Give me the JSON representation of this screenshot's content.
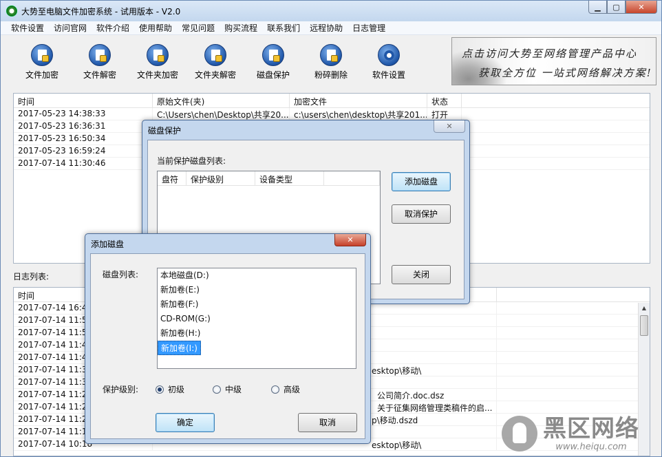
{
  "window": {
    "title": "大势至电脑文件加密系统 - 试用版本 - V2.0"
  },
  "menu": [
    "软件设置",
    "访问官网",
    "软件介绍",
    "使用帮助",
    "常见问题",
    "购买流程",
    "联系我们",
    "远程协助",
    "日志管理"
  ],
  "toolbar": [
    {
      "label": "文件加密",
      "icon": "file-lock-icon"
    },
    {
      "label": "文件解密",
      "icon": "file-unlock-icon"
    },
    {
      "label": "文件夹加密",
      "icon": "folder-lock-icon"
    },
    {
      "label": "文件夹解密",
      "icon": "folder-unlock-icon"
    },
    {
      "label": "磁盘保护",
      "icon": "disk-shield-icon"
    },
    {
      "label": "粉碎删除",
      "icon": "shred-icon"
    },
    {
      "label": "软件设置",
      "icon": "gear-icon"
    }
  ],
  "banner": {
    "line1": "点击访问大势至网络管理产品中心",
    "line2": "获取全方位 一站式网络解决方案!"
  },
  "records": {
    "columns": [
      "时间",
      "原始文件(夹)",
      "加密文件",
      "状态"
    ],
    "rows": [
      [
        "2017-05-23 14:38:33",
        "C:\\Users\\chen\\Desktop\\共享20...",
        "c:\\users\\chen\\desktop\\共享201...",
        "打开"
      ],
      [
        "2017-05-23 16:36:31",
        "",
        "",
        ""
      ],
      [
        "2017-05-23 16:50:34",
        "",
        "",
        ""
      ],
      [
        "2017-05-23 16:59:24",
        "",
        "",
        ""
      ],
      [
        "2017-07-14 11:30:46",
        "",
        "",
        ""
      ]
    ]
  },
  "log": {
    "label": "日志列表:",
    "columns": [
      "时间"
    ],
    "rows": [
      [
        "2017-07-14 16:47",
        ""
      ],
      [
        "2017-07-14 11:51",
        ""
      ],
      [
        "2017-07-14 11:50",
        ""
      ],
      [
        "2017-07-14 11:48",
        ""
      ],
      [
        "2017-07-14 11:47",
        ""
      ],
      [
        "2017-07-14 11:30",
        "esktop\\移动\\"
      ],
      [
        "2017-07-14 11:30",
        ""
      ],
      [
        "2017-07-14 11:26",
        "公司简介.doc.dsz"
      ],
      [
        "2017-07-14 11:26",
        "关于征集网络管理类稿件的启..."
      ],
      [
        "2017-07-14 11:25",
        "p\\移动.dszd"
      ],
      [
        "2017-07-14 11:13",
        ""
      ],
      [
        "2017-07-14 10:18",
        "esktop\\移动\\"
      ]
    ]
  },
  "disk_protect": {
    "title": "磁盘保护",
    "list_label": "当前保护磁盘列表:",
    "columns": [
      "盘符",
      "保护级别",
      "设备类型"
    ],
    "add_button": "添加磁盘",
    "remove_button": "取消保护",
    "close_button": "关闭"
  },
  "add_disk": {
    "title": "添加磁盘",
    "list_label": "磁盘列表:",
    "disks": [
      "本地磁盘(D:)",
      "新加卷(E:)",
      "新加卷(F:)",
      "CD-ROM(G:)",
      "新加卷(H:)",
      "新加卷(I:)"
    ],
    "selected_index": 5,
    "level_label": "保护级别:",
    "levels": [
      "初级",
      "中级",
      "高级"
    ],
    "selected_level": 0,
    "ok_button": "确定",
    "cancel_button": "取消"
  },
  "watermark": {
    "text": "黑区网络",
    "url": "www.heiqu.com"
  }
}
